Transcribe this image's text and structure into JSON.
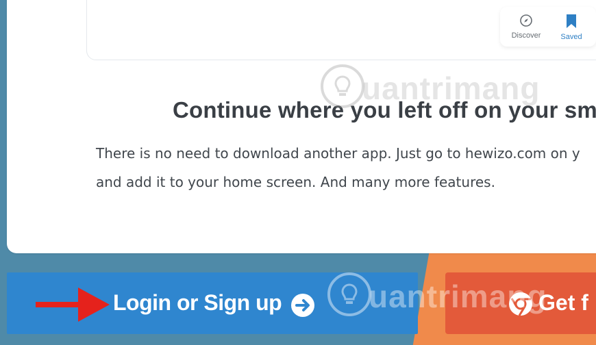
{
  "mini_nav": {
    "discover_label": "Discover",
    "saved_label": "Saved"
  },
  "content": {
    "heading": "Continue where you left off on your sma",
    "paragraph_line1": "There is no need to download another app. Just go to hewizo.com on y",
    "paragraph_line2": "and add it to your home screen. And many more features."
  },
  "actions": {
    "login_label": "Login or Sign up",
    "get_label": "Get f"
  },
  "watermark": {
    "text": "uantrimang"
  },
  "colors": {
    "login_button": "#2f86cf",
    "get_button": "#e35a3a",
    "background_blue": "#4f8aa8",
    "background_orange": "#f08a4b",
    "annotation_arrow": "#e5221c",
    "saved_accent": "#2e7fc4"
  },
  "icons": {
    "discover": "compass-icon",
    "saved": "bookmark-icon",
    "login_arrow": "arrow-right-circle-icon",
    "get": "chrome-icon",
    "annotation": "red-arrow-icon",
    "watermark": "lightbulb-icon"
  }
}
